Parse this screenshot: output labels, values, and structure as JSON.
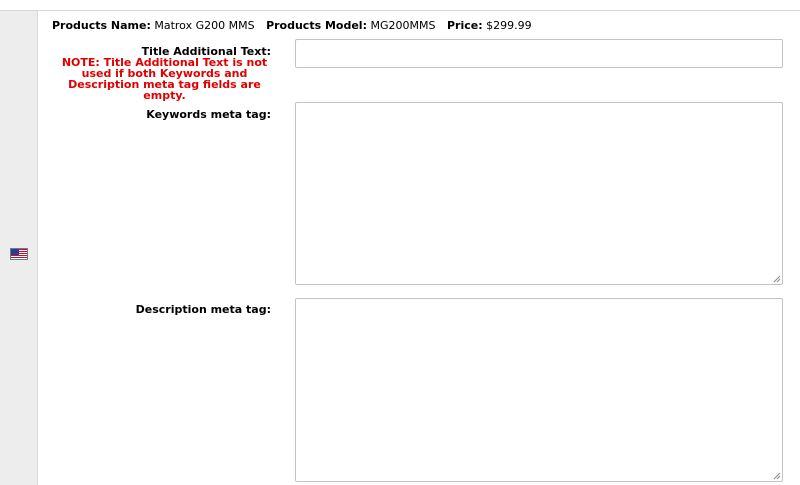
{
  "product": {
    "name_label": "Products Name:",
    "name_value": "Matrox G200 MMS",
    "model_label": "Products Model:",
    "model_value": "MG200MMS",
    "price_label": "Price:",
    "price_value": "$299.99"
  },
  "form": {
    "title_label": "Title Additional Text:",
    "note": "NOTE: Title Additional Text is not used if both Keywords and Description meta tag fields are empty.",
    "title_value": "",
    "keywords_label": "Keywords meta tag:",
    "keywords_value": "",
    "description_label": "Description meta tag:",
    "description_value": ""
  },
  "language": {
    "flag_icon": "us-flag-icon"
  },
  "colors": {
    "note": "#e00000",
    "sidebar": "#ededed",
    "border": "#c4c4c4"
  }
}
